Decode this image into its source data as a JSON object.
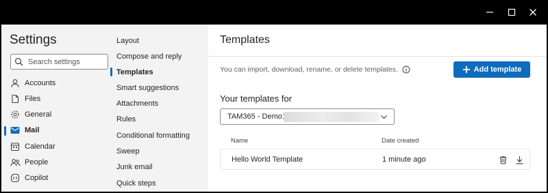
{
  "window": {
    "minimize_icon": "minimize-icon",
    "maximize_icon": "maximize-icon",
    "close_icon": "close-icon"
  },
  "settings": {
    "title": "Settings",
    "search_placeholder": "Search settings",
    "categories": [
      {
        "label": "Accounts",
        "icon": "person-icon",
        "selected": false
      },
      {
        "label": "Files",
        "icon": "file-icon",
        "selected": false
      },
      {
        "label": "General",
        "icon": "gear-icon",
        "selected": false
      },
      {
        "label": "Mail",
        "icon": "mail-icon",
        "selected": true
      },
      {
        "label": "Calendar",
        "icon": "calendar-icon",
        "selected": false
      },
      {
        "label": "People",
        "icon": "people-icon",
        "selected": false
      },
      {
        "label": "Copilot",
        "icon": "copilot-icon",
        "selected": false
      }
    ],
    "subcategories": [
      {
        "label": "Layout",
        "selected": false
      },
      {
        "label": "Compose and reply",
        "selected": false
      },
      {
        "label": "Templates",
        "selected": true
      },
      {
        "label": "Smart suggestions",
        "selected": false
      },
      {
        "label": "Attachments",
        "selected": false
      },
      {
        "label": "Rules",
        "selected": false
      },
      {
        "label": "Conditional formatting",
        "selected": false
      },
      {
        "label": "Sweep",
        "selected": false
      },
      {
        "label": "Junk email",
        "selected": false
      },
      {
        "label": "Quick steps",
        "selected": false
      }
    ]
  },
  "content": {
    "title": "Templates",
    "description": "You can import, download, rename, or delete templates.",
    "add_button_label": "Add template",
    "your_templates_label": "Your templates for",
    "account_selected": "TAM365 - Demo1",
    "table": {
      "headers": {
        "name": "Name",
        "date": "Date created"
      },
      "rows": [
        {
          "name": "Hello World Template",
          "date": "1 minute ago"
        }
      ]
    }
  },
  "colors": {
    "accent": "#0f6cbd",
    "sidebar_bg": "#f3f3f3",
    "titlebar_bg": "#000000"
  }
}
